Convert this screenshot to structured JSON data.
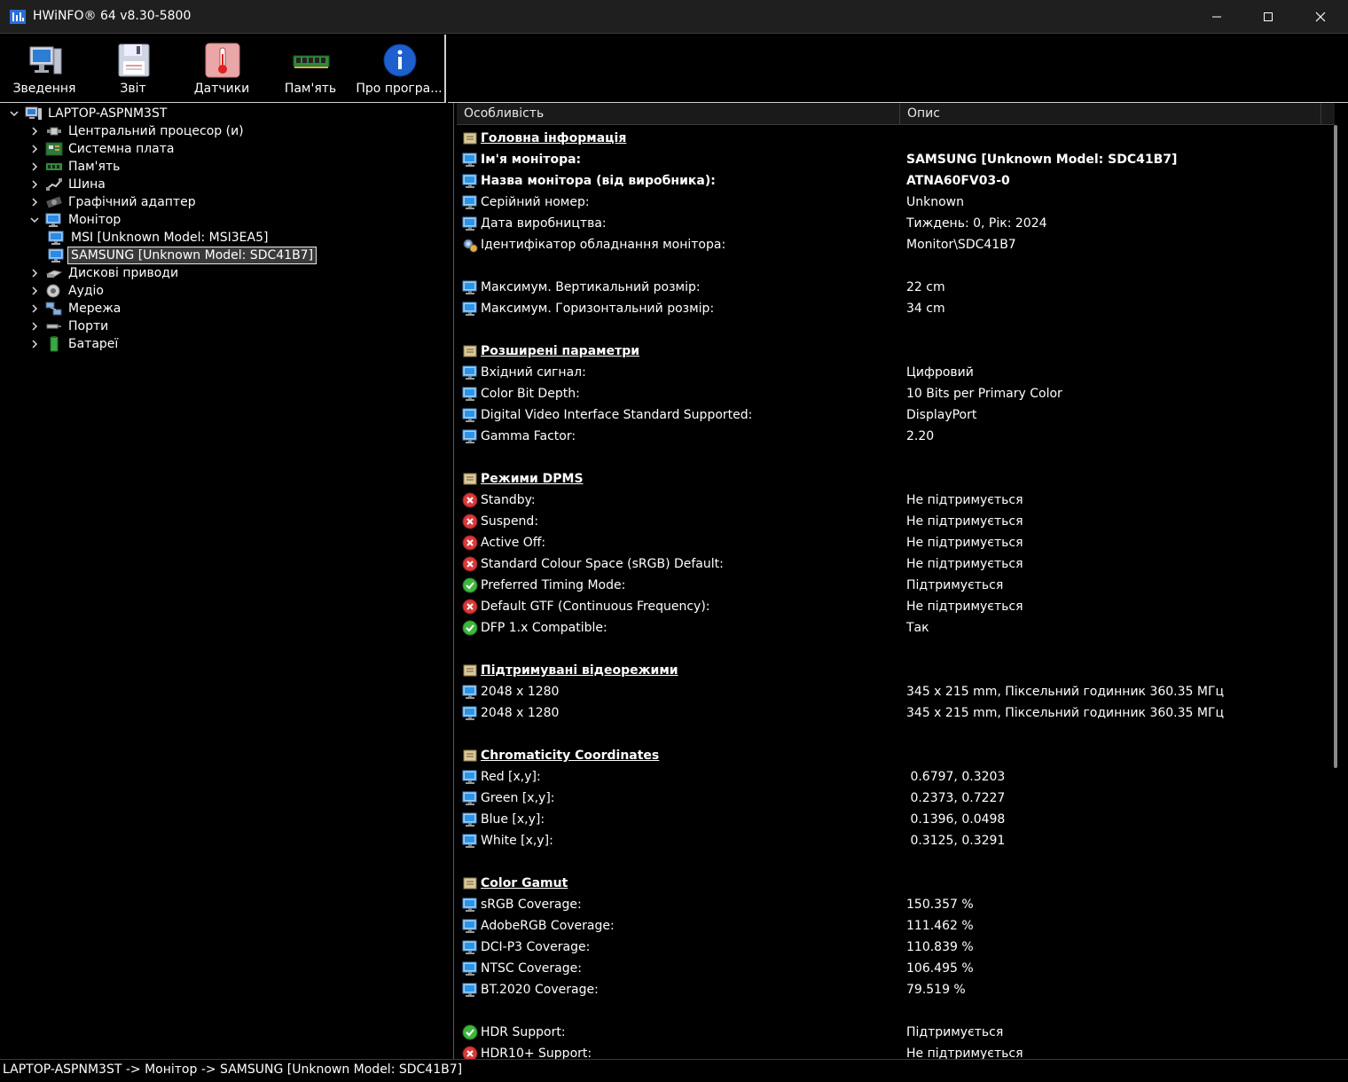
{
  "window": {
    "title": "HWiNFO® 64 v8.30-5800"
  },
  "toolbar": [
    {
      "label": "Зведення",
      "icon": "monitor-summary-icon"
    },
    {
      "label": "Звіт",
      "icon": "floppy-disk-icon"
    },
    {
      "label": "Датчики",
      "icon": "thermometer-icon"
    },
    {
      "label": "Пам'ять",
      "icon": "memory-stick-icon"
    },
    {
      "label": "Про програ...",
      "icon": "info-icon"
    }
  ],
  "tree": [
    {
      "label": "LAPTOP-ASPNM3ST",
      "icon": "computer-icon",
      "level": 0,
      "expanded": true
    },
    {
      "label": "Центральний процесор (и)",
      "icon": "cpu-icon",
      "level": 1,
      "expanded": false
    },
    {
      "label": "Системна плата",
      "icon": "motherboard-icon",
      "level": 1,
      "expanded": false
    },
    {
      "label": "Пам'ять",
      "icon": "memory-icon",
      "level": 1,
      "expanded": false
    },
    {
      "label": "Шина",
      "icon": "bus-icon",
      "level": 1,
      "expanded": false
    },
    {
      "label": "Графічний адаптер",
      "icon": "gpu-icon",
      "level": 1,
      "expanded": false
    },
    {
      "label": "Монітор",
      "icon": "monitor-icon",
      "level": 1,
      "expanded": true
    },
    {
      "label": "MSI [Unknown Model: MSI3EA5]",
      "icon": "monitor-icon",
      "level": 2
    },
    {
      "label": "SAMSUNG [Unknown Model: SDC41B7]",
      "icon": "monitor-icon",
      "level": 2,
      "selected": true
    },
    {
      "label": "Дискові приводи",
      "icon": "drive-icon",
      "level": 1,
      "expanded": false
    },
    {
      "label": "Аудіо",
      "icon": "audio-icon",
      "level": 1,
      "expanded": false
    },
    {
      "label": "Мережа",
      "icon": "network-icon",
      "level": 1,
      "expanded": false
    },
    {
      "label": "Порти",
      "icon": "port-icon",
      "level": 1,
      "expanded": false
    },
    {
      "label": "Батареї",
      "icon": "battery-icon",
      "level": 1,
      "expanded": false
    }
  ],
  "columns": {
    "feature": "Особливість",
    "description": "Опис"
  },
  "rows": [
    {
      "type": "section",
      "label": "Головна інформація",
      "value": ""
    },
    {
      "type": "bold",
      "icon": "monitor",
      "label": "Ім'я монітора:",
      "value": "SAMSUNG [Unknown Model: SDC41B7]"
    },
    {
      "type": "bold",
      "icon": "monitor",
      "label": "Назва монітора (від виробника):",
      "value": "ATNA60FV03-0"
    },
    {
      "type": "item",
      "icon": "monitor",
      "label": "Серійний номер:",
      "value": "Unknown"
    },
    {
      "type": "item",
      "icon": "monitor",
      "label": "Дата виробництва:",
      "value": "Тиждень: 0, Рік: 2024"
    },
    {
      "type": "item",
      "icon": "hwid",
      "label": "Ідентифікатор обладнання монітора:",
      "value": "Monitor\\SDC41B7"
    },
    {
      "type": "blank"
    },
    {
      "type": "item",
      "icon": "monitor",
      "label": "Максимум. Вертикальний розмір:",
      "value": "22 cm"
    },
    {
      "type": "item",
      "icon": "monitor",
      "label": "Максимум. Горизонтальний розмір:",
      "value": "34 cm"
    },
    {
      "type": "blank"
    },
    {
      "type": "section",
      "label": "Розширені параметри",
      "value": ""
    },
    {
      "type": "item",
      "icon": "monitor",
      "label": "Вхідний сигнал:",
      "value": "Цифровий"
    },
    {
      "type": "item",
      "icon": "monitor",
      "label": "Color Bit Depth:",
      "value": "10 Bits per Primary Color"
    },
    {
      "type": "item",
      "icon": "monitor",
      "label": "Digital Video Interface Standard Supported:",
      "value": "DisplayPort"
    },
    {
      "type": "item",
      "icon": "monitor",
      "label": "Gamma Factor:",
      "value": "2.20"
    },
    {
      "type": "blank"
    },
    {
      "type": "section",
      "label": "Режими DPMS",
      "value": ""
    },
    {
      "type": "item",
      "icon": "no",
      "label": "Standby:",
      "value": "Не підтримується"
    },
    {
      "type": "item",
      "icon": "no",
      "label": "Suspend:",
      "value": "Не підтримується"
    },
    {
      "type": "item",
      "icon": "no",
      "label": "Active Off:",
      "value": "Не підтримується"
    },
    {
      "type": "item",
      "icon": "no",
      "label": "Standard Colour Space (sRGB) Default:",
      "value": "Не підтримується"
    },
    {
      "type": "item",
      "icon": "yes",
      "label": "Preferred Timing Mode:",
      "value": "Підтримується"
    },
    {
      "type": "item",
      "icon": "no",
      "label": "Default GTF (Continuous Frequency):",
      "value": "Не підтримується"
    },
    {
      "type": "item",
      "icon": "yes",
      "label": "DFP 1.x Compatible:",
      "value": "Так"
    },
    {
      "type": "blank"
    },
    {
      "type": "section",
      "label": "Підтримувані відеорежими",
      "value": ""
    },
    {
      "type": "item",
      "icon": "monitor",
      "label": "2048 x 1280",
      "value": "345 x 215 mm, Піксельний годинник 360.35 МГц"
    },
    {
      "type": "item",
      "icon": "monitor",
      "label": "2048 x 1280",
      "value": "345 x 215 mm, Піксельний годинник 360.35 МГц"
    },
    {
      "type": "blank"
    },
    {
      "type": "section",
      "label": "Chromaticity Coordinates",
      "value": ""
    },
    {
      "type": "item",
      "icon": "monitor",
      "label": "Red [x,y]:",
      "value": " 0.6797, 0.3203"
    },
    {
      "type": "item",
      "icon": "monitor",
      "label": "Green [x,y]:",
      "value": " 0.2373, 0.7227"
    },
    {
      "type": "item",
      "icon": "monitor",
      "label": "Blue [x,y]:",
      "value": " 0.1396, 0.0498"
    },
    {
      "type": "item",
      "icon": "monitor",
      "label": "White [x,y]:",
      "value": " 0.3125, 0.3291"
    },
    {
      "type": "blank"
    },
    {
      "type": "section",
      "label": "Color Gamut",
      "value": ""
    },
    {
      "type": "item",
      "icon": "monitor",
      "label": "sRGB Coverage:",
      "value": "150.357 %"
    },
    {
      "type": "item",
      "icon": "monitor",
      "label": "AdobeRGB Coverage:",
      "value": "111.462 %"
    },
    {
      "type": "item",
      "icon": "monitor",
      "label": "DCI-P3 Coverage:",
      "value": "110.839 %"
    },
    {
      "type": "item",
      "icon": "monitor",
      "label": "NTSC Coverage:",
      "value": "106.495 %"
    },
    {
      "type": "item",
      "icon": "monitor",
      "label": "BT.2020 Coverage:",
      "value": "79.519 %"
    },
    {
      "type": "blank"
    },
    {
      "type": "item",
      "icon": "yes",
      "label": "HDR Support:",
      "value": "Підтримується"
    },
    {
      "type": "item",
      "icon": "no",
      "label": "HDR10+ Support:",
      "value": "Не підтримується"
    }
  ],
  "status": {
    "path": "LAPTOP-ASPNM3ST -> Монітор -> SAMSUNG [Unknown Model: SDC41B7]"
  }
}
